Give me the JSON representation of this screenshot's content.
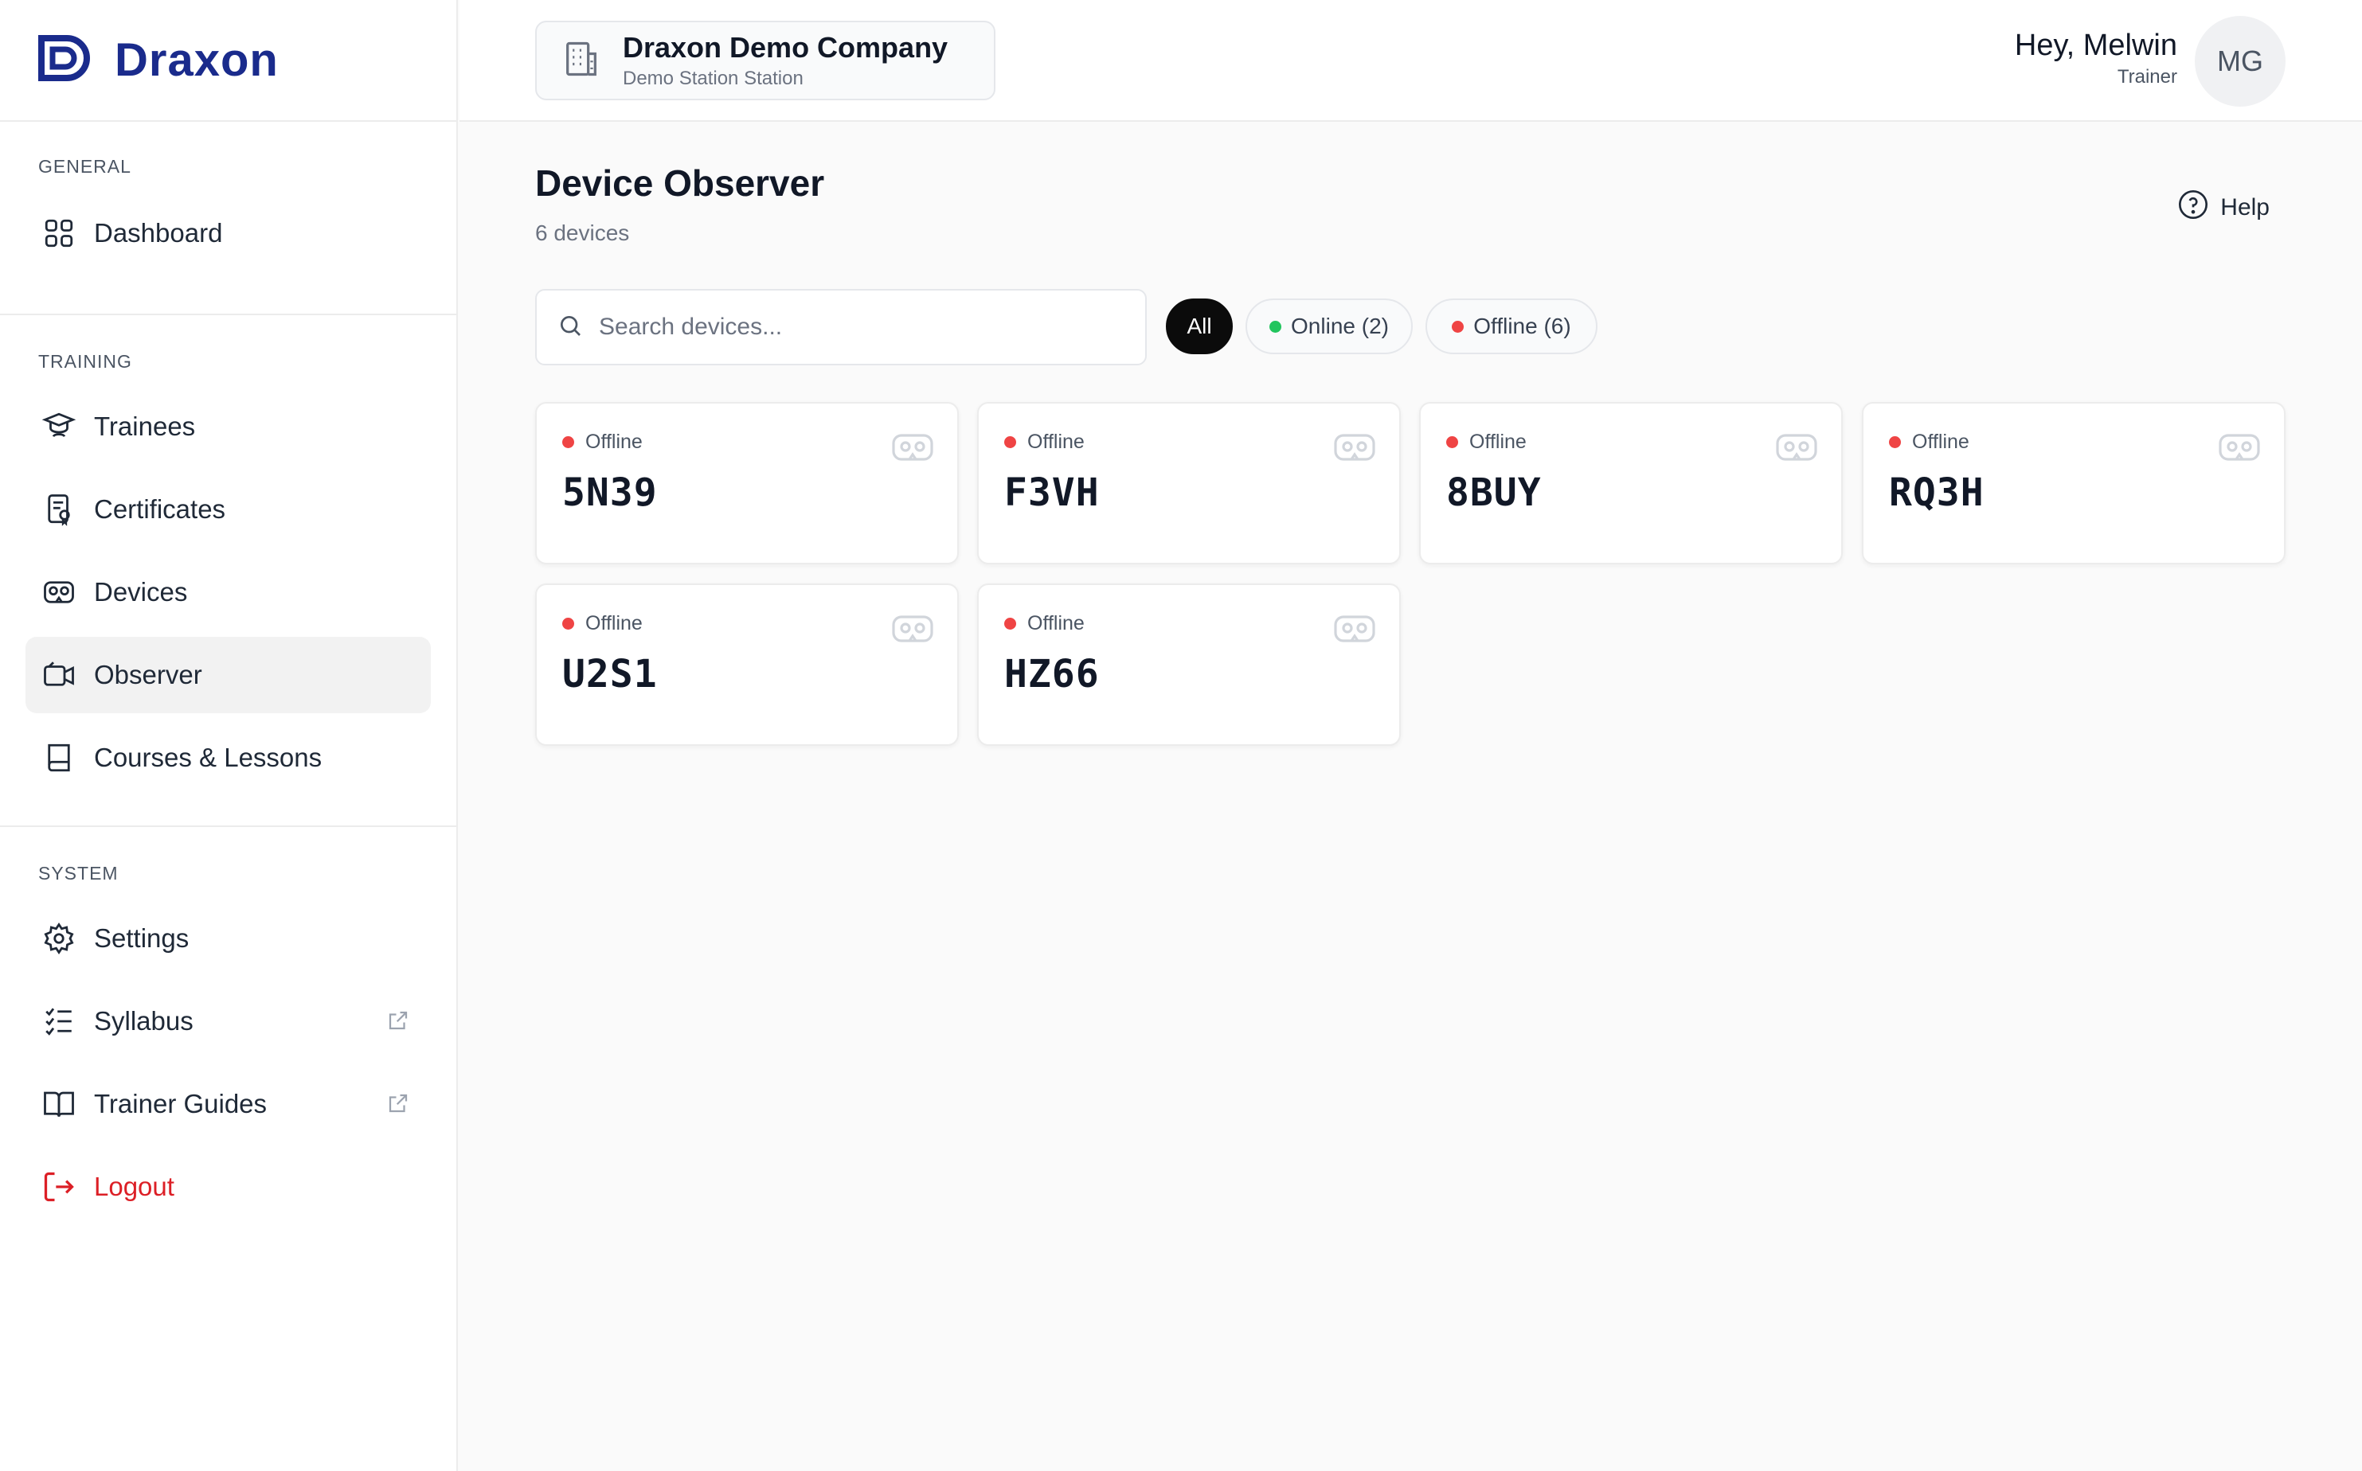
{
  "brand": {
    "name": "Draxon",
    "color": "#1a2b8c"
  },
  "company": {
    "name": "Draxon Demo Company",
    "subtitle": "Demo Station Station"
  },
  "user": {
    "greeting": "Hey, Melwin",
    "role": "Trainer",
    "initials": "MG"
  },
  "sidebar": {
    "sections": [
      {
        "label": "GENERAL",
        "items": [
          {
            "label": "Dashboard",
            "icon": "grid-icon"
          }
        ]
      },
      {
        "label": "TRAINING",
        "items": [
          {
            "label": "Trainees",
            "icon": "graduation-cap-icon"
          },
          {
            "label": "Certificates",
            "icon": "certificate-icon"
          },
          {
            "label": "Devices",
            "icon": "vr-headset-icon"
          },
          {
            "label": "Observer",
            "icon": "video-camera-icon",
            "active": true
          },
          {
            "label": "Courses & Lessons",
            "icon": "book-icon"
          }
        ]
      },
      {
        "label": "SYSTEM",
        "items": [
          {
            "label": "Settings",
            "icon": "gear-icon"
          },
          {
            "label": "Syllabus",
            "icon": "checklist-icon",
            "external": true
          },
          {
            "label": "Trainer Guides",
            "icon": "open-book-icon",
            "external": true
          },
          {
            "label": "Logout",
            "icon": "logout-icon"
          }
        ]
      }
    ]
  },
  "page": {
    "title": "Device Observer",
    "subtitle": "6 devices",
    "help_label": "Help"
  },
  "search": {
    "placeholder": "Search devices...",
    "value": ""
  },
  "filters": [
    {
      "label": "All",
      "active": true
    },
    {
      "label": "Online (2)",
      "dot_color": "#22c55e"
    },
    {
      "label": "Offline (6)",
      "dot_color": "#ef4444"
    }
  ],
  "devices": [
    {
      "code": "5N39",
      "status": "Offline"
    },
    {
      "code": "F3VH",
      "status": "Offline"
    },
    {
      "code": "8BUY",
      "status": "Offline"
    },
    {
      "code": "RQ3H",
      "status": "Offline"
    },
    {
      "code": "U2S1",
      "status": "Offline"
    },
    {
      "code": "HZ66",
      "status": "Offline"
    }
  ],
  "colors": {
    "offline": "#ef4444",
    "online": "#22c55e",
    "logout": "#dc1f26"
  }
}
